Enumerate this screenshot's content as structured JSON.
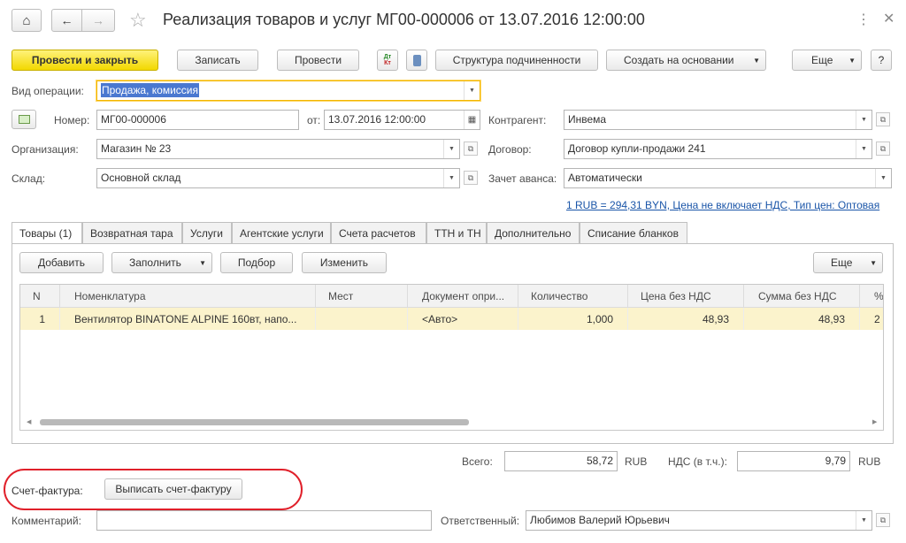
{
  "window": {
    "title": "Реализация товаров и услуг МГ00-000006 от 13.07.2016 12:00:00"
  },
  "toolbar": {
    "post_close": "Провести и закрыть",
    "save": "Записать",
    "post": "Провести",
    "dt_kt": "Дт\nКт",
    "structure": "Структура подчиненности",
    "create_based": "Создать на основании",
    "more": "Еще",
    "help": "?"
  },
  "form": {
    "operation_label": "Вид операции:",
    "operation_value": "Продажа, комиссия",
    "number_label": "Номер:",
    "number_value": "МГ00-000006",
    "date_label": "от:",
    "date_value": "13.07.2016 12:00:00",
    "counterparty_label": "Контрагент:",
    "counterparty_value": "Инвема",
    "org_label": "Организация:",
    "org_value": "Магазин № 23",
    "contract_label": "Договор:",
    "contract_value": "Договор купли-продажи 241",
    "warehouse_label": "Склад:",
    "warehouse_value": "Основной склад",
    "advance_label": "Зачет аванса:",
    "advance_value": "Автоматически",
    "price_link": "1 RUB = 294,31 BYN, Цена не включает НДС, Тип цен: Оптовая"
  },
  "tabs": [
    {
      "label": "Товары (1)"
    },
    {
      "label": "Возвратная тара"
    },
    {
      "label": "Услуги"
    },
    {
      "label": "Агентские услуги"
    },
    {
      "label": "Счета расчетов"
    },
    {
      "label": "ТТН и ТН"
    },
    {
      "label": "Дополнительно"
    },
    {
      "label": "Списание бланков"
    }
  ],
  "table_toolbar": {
    "add": "Добавить",
    "fill": "Заполнить",
    "select": "Подбор",
    "change": "Изменить",
    "more": "Еще"
  },
  "table": {
    "columns": [
      "N",
      "Номенклатура",
      "Мест",
      "Документ опри...",
      "Количество",
      "Цена без НДС",
      "Сумма без НДС",
      "%"
    ],
    "rows": [
      {
        "n": "1",
        "item": "Вентилятор BINATONE ALPINE 160вт, напо...",
        "places": "",
        "doc": "<Авто>",
        "qty": "1,000",
        "price": "48,93",
        "sum": "48,93",
        "pct": "2"
      }
    ]
  },
  "totals": {
    "total_label": "Всего:",
    "total_value": "58,72",
    "total_currency": "RUB",
    "vat_label": "НДС (в т.ч.):",
    "vat_value": "9,79",
    "vat_currency": "RUB"
  },
  "invoice": {
    "label": "Счет-фактура:",
    "button": "Выписать счет-фактуру"
  },
  "footer": {
    "comment_label": "Комментарий:",
    "comment_value": "",
    "responsible_label": "Ответственный:",
    "responsible_value": "Любимов Валерий Юрьевич"
  },
  "colors": {
    "primary_button": "#f2d800",
    "selection": "#4a78d0",
    "row_highlight": "#fbf3cc",
    "link": "#1a55a8",
    "invoice_circle": "#e0202a"
  }
}
